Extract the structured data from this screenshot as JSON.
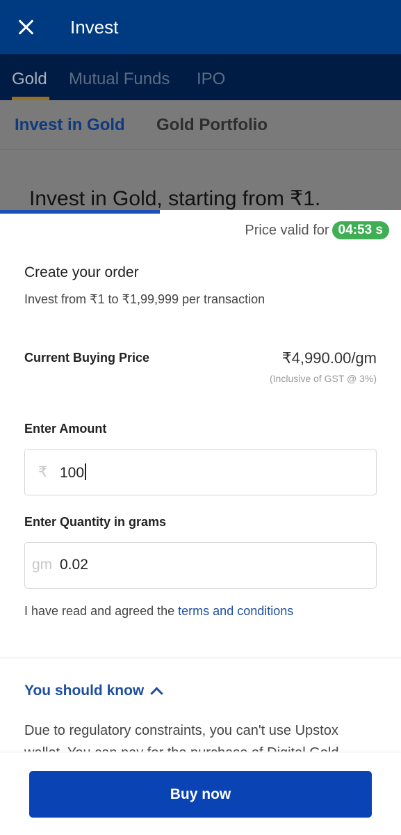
{
  "appbar": {
    "title": "Invest"
  },
  "tabs": [
    {
      "label": "Gold"
    },
    {
      "label": "Mutual Funds"
    },
    {
      "label": "IPO"
    }
  ],
  "subtabs": [
    {
      "label": "Invest in Gold"
    },
    {
      "label": "Gold Portfolio"
    }
  ],
  "hero_text": "Invest in Gold, starting from ₹1.",
  "sheet": {
    "price_valid_label": "Price valid for",
    "timer": "04:53 s",
    "order_title": "Create your order",
    "order_subtitle": "Invest from ₹1 to ₹1,99,999 per transaction",
    "price_label": "Current Buying Price",
    "price_value": "₹4,990.00/gm",
    "price_note": "(Inclusive of GST @ 3%)",
    "amount": {
      "label": "Enter Amount",
      "prefix": "₹",
      "value": "100"
    },
    "quantity": {
      "label": "Enter Quantity in grams",
      "prefix": "gm",
      "value": "0.02"
    },
    "terms_text": "I have read and agreed the ",
    "terms_link": "terms and conditions",
    "know_title": "You should know",
    "know_text": "Due to regulatory constraints, you can't use Upstox wallet. You can pay for the purchase of Digital Gold",
    "buy_label": "Buy now"
  },
  "colors": {
    "appbar": "#003a80",
    "accent": "#0a43b4",
    "timer": "#3fae55",
    "link": "#1f4fa0"
  }
}
